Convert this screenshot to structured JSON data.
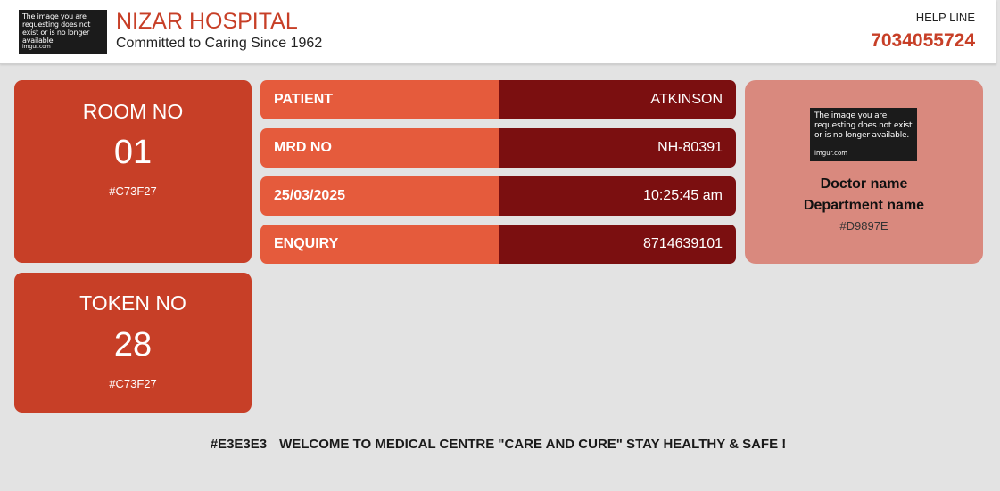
{
  "header": {
    "logo": {
      "message": "The image you are requesting does not exist or is no longer available.",
      "source": "imgur.com"
    },
    "hospital_name": "NIZAR HOSPITAL",
    "tagline": "Committed to Caring Since 1962",
    "helpline_label": "HELP LINE",
    "helpline_number": "7034055724"
  },
  "room": {
    "label": "ROOM NO",
    "value": "01",
    "color_hex": "#C73F27"
  },
  "token": {
    "label": "TOKEN NO",
    "value": "28",
    "color_hex": "#C73F27"
  },
  "info_rows": [
    {
      "key": "PATIENT",
      "value": "ATKINSON"
    },
    {
      "key": "MRD NO",
      "value": "NH-80391"
    },
    {
      "key": "25/03/2025",
      "value": "10:25:45 am"
    },
    {
      "key": "ENQUIRY",
      "value": "8714639101"
    }
  ],
  "doctor": {
    "photo": {
      "message": "The image you are requesting does not exist or is no longer available.",
      "source": "imgur.com"
    },
    "name": "Doctor name",
    "department": "Department name",
    "color_hex": "#D9897E"
  },
  "footer": {
    "color_hex": "#E3E3E3",
    "message": "WELCOME TO MEDICAL CENTRE \"CARE AND CURE\" STAY HEALTHY & SAFE !"
  },
  "colors": {
    "accent": "#C73F27",
    "key_bg": "#E55B3C",
    "value_bg": "#7B0F10",
    "doctor_bg": "#D9897E",
    "page_bg": "#E3E3E3"
  }
}
